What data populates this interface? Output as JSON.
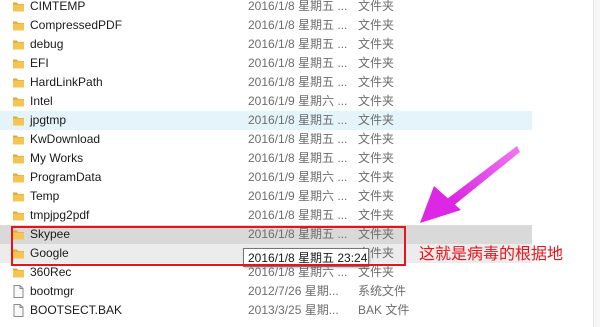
{
  "files": [
    {
      "name": "CIMTEMP",
      "date": "2016/1/8 星期五 ...",
      "type": "文件夹",
      "icon": "folder-icon",
      "state": "cut"
    },
    {
      "name": "CompressedPDF",
      "date": "2016/1/8 星期五 ...",
      "type": "文件夹",
      "icon": "folder-icon"
    },
    {
      "name": "debug",
      "date": "2016/1/8 星期五 ...",
      "type": "文件夹",
      "icon": "folder-icon"
    },
    {
      "name": "EFI",
      "date": "2016/1/8 星期五 ...",
      "type": "文件夹",
      "icon": "folder-icon"
    },
    {
      "name": "HardLinkPath",
      "date": "2016/1/8 星期五 ...",
      "type": "文件夹",
      "icon": "folder-icon"
    },
    {
      "name": "Intel",
      "date": "2016/1/9 星期六 ...",
      "type": "文件夹",
      "icon": "folder-icon"
    },
    {
      "name": "jpgtmp",
      "date": "2016/1/8 星期五 ...",
      "type": "文件夹",
      "icon": "folder-icon",
      "state": "hover"
    },
    {
      "name": "KwDownload",
      "date": "2016/1/8 星期五 ...",
      "type": "文件夹",
      "icon": "folder-icon"
    },
    {
      "name": "My Works",
      "date": "2016/1/8 星期五 ...",
      "type": "文件夹",
      "icon": "folder-icon"
    },
    {
      "name": "ProgramData",
      "date": "2016/1/9 星期六 ...",
      "type": "文件夹",
      "icon": "folder-icon"
    },
    {
      "name": "Temp",
      "date": "2016/1/9 星期六 ...",
      "type": "文件夹",
      "icon": "folder-icon"
    },
    {
      "name": "tmpjpg2pdf",
      "date": "2016/1/8 星期五 ...",
      "type": "文件夹",
      "icon": "folder-icon"
    },
    {
      "name": "Skypee",
      "date": "2016/1/8 星期五 ...",
      "type": "文件夹",
      "icon": "folder-icon",
      "state": "selected"
    },
    {
      "name": "Google",
      "date": "",
      "type": "文件夹",
      "icon": "folder-icon",
      "state": "selected-light"
    },
    {
      "name": "360Rec",
      "date": "2016/1/8 星期六 ...",
      "type": "文件夹",
      "icon": "folder-icon"
    },
    {
      "name": "bootmgr",
      "date": "2012/7/26 星期...",
      "type": "系统文件",
      "icon": "file-icon"
    },
    {
      "name": "BOOTSECT.BAK",
      "date": "2013/3/25 星期...",
      "type": "BAK 文件",
      "icon": "file-icon",
      "state": "cut-bottom"
    }
  ],
  "tooltip": "2016/1/8 星期五 23:24",
  "annotation": "这就是病毒的根据地",
  "colors": {
    "folder": "#f4c454",
    "folder_dark": "#e0a82e",
    "annotation_red": "#e8141b",
    "arrow_magenta": "#e232e6"
  }
}
